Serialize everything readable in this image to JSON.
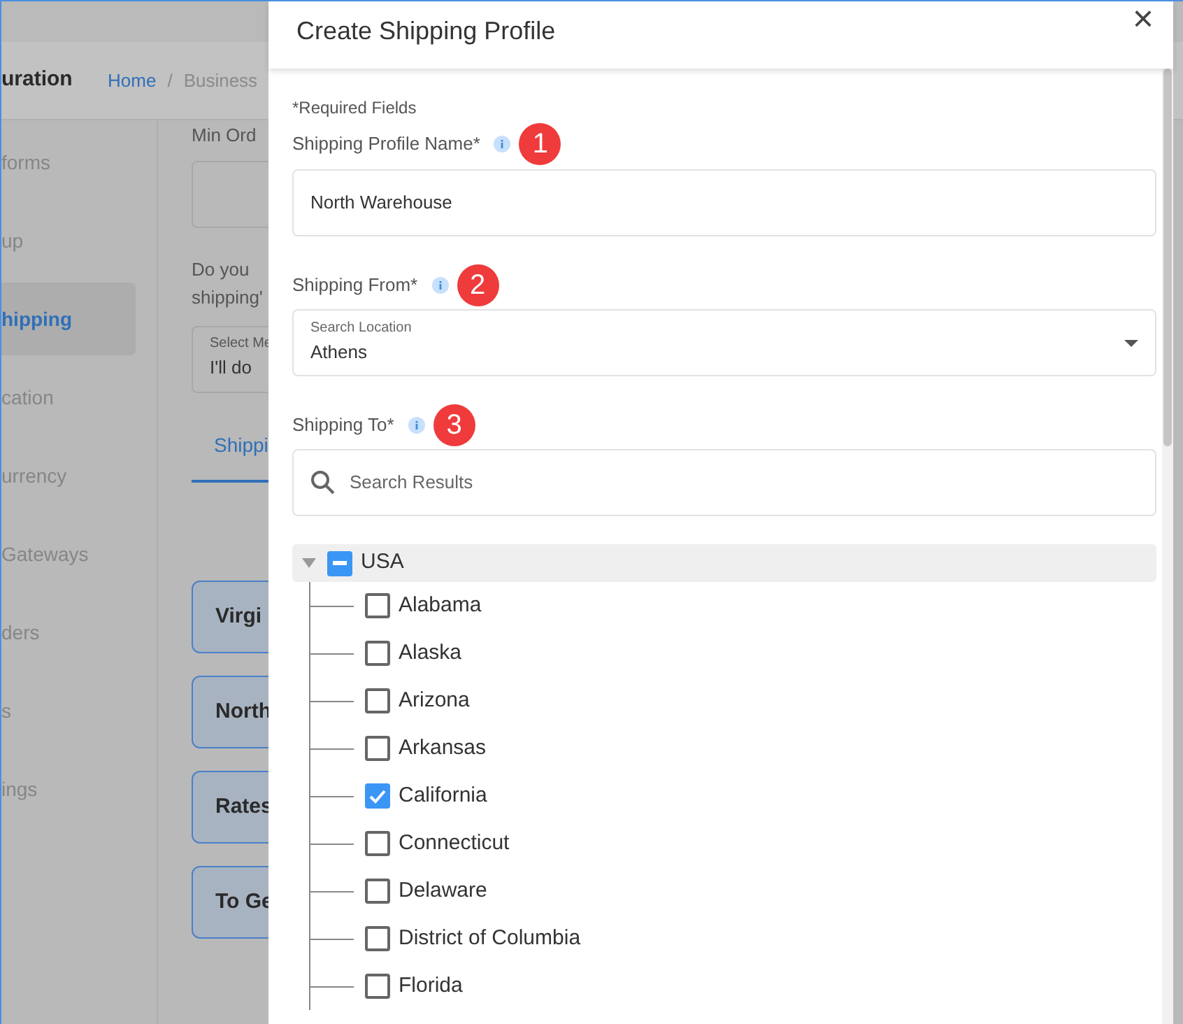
{
  "page": {
    "title": "uration",
    "separator": "/",
    "breadcrumb": [
      {
        "label": "Home",
        "kind": "link"
      },
      {
        "label": "Business",
        "kind": "current"
      }
    ]
  },
  "sidebar": {
    "items": [
      {
        "label": "forms",
        "selected": false
      },
      {
        "label": "up",
        "selected": false
      },
      {
        "label": "hipping",
        "selected": true
      },
      {
        "label": "cation",
        "selected": false
      },
      {
        "label": "urrency",
        "selected": false
      },
      {
        "label": "Gateways",
        "selected": false
      },
      {
        "label": "ders",
        "selected": false
      },
      {
        "label": "s",
        "selected": false
      },
      {
        "label": "ings",
        "selected": false
      }
    ]
  },
  "content": {
    "min_order_label": "Min Ord",
    "question": "Do you shipping'",
    "select": {
      "label": "Select Me",
      "value": "I'll do"
    },
    "tab": {
      "label": "Shippi",
      "selected": true
    },
    "cards": [
      "Virgi",
      "North",
      "Rates",
      "To Ge"
    ]
  },
  "dialog": {
    "title": "Create Shipping Profile",
    "close": "×",
    "required_note": "*Required Fields",
    "profile_name": {
      "label": "Shipping Profile Name*",
      "badge": "1",
      "value": "North Warehouse"
    },
    "shipping_from": {
      "label": "Shipping From*",
      "badge": "2",
      "floating_label": "Search Location",
      "value": "Athens"
    },
    "shipping_to": {
      "label": "Shipping To*",
      "badge": "3",
      "placeholder": "Search Results"
    },
    "tree": [
      {
        "label": "USA",
        "expanded": true,
        "indeterminate": true,
        "children": [
          {
            "label": "Alabama",
            "checked": false
          },
          {
            "label": "Alaska",
            "checked": false
          },
          {
            "label": "Arizona",
            "checked": false
          },
          {
            "label": "Arkansas",
            "checked": false
          },
          {
            "label": "California",
            "checked": true
          },
          {
            "label": "Connecticut",
            "checked": false
          },
          {
            "label": "Delaware",
            "checked": false
          },
          {
            "label": "District of Columbia",
            "checked": false
          },
          {
            "label": "Florida",
            "checked": false
          }
        ]
      }
    ]
  }
}
